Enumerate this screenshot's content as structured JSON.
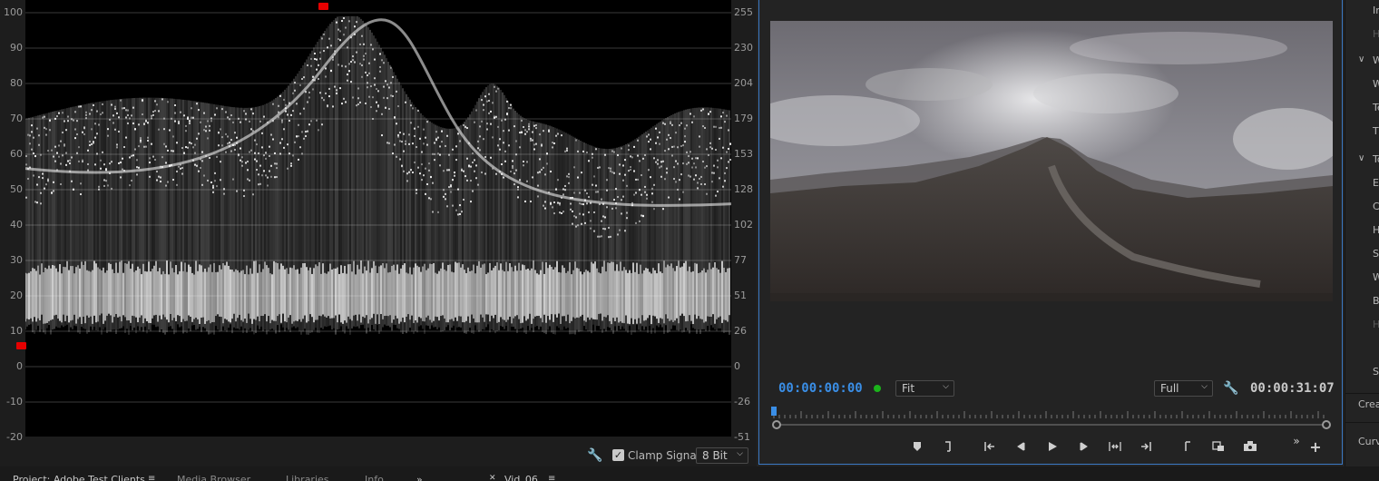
{
  "scope": {
    "left_ticks": [
      "100",
      "90",
      "80",
      "70",
      "60",
      "50",
      "40",
      "30",
      "20",
      "10",
      "0",
      "-10",
      "-20"
    ],
    "right_ticks": [
      "255",
      "230",
      "204",
      "179",
      "153",
      "128",
      "102",
      "77",
      "51",
      "26",
      "0",
      "-26",
      "-51"
    ],
    "clamp_label": "Clamp Signal",
    "clamp_checked": true,
    "bit_depth": "8 Bit"
  },
  "monitor": {
    "current_timecode": "00:00:00:00",
    "duration_timecode": "00:00:31:07",
    "zoom": "Fit",
    "resolution": "Full"
  },
  "transport": {
    "buttons": [
      "add-marker",
      "mark-in",
      "mark-out",
      "go-to-in",
      "step-back",
      "play",
      "step-forward",
      "go-to-out",
      "lift",
      "extract",
      "export-frame",
      "compare",
      "vr-view"
    ]
  },
  "right_panel": {
    "items": [
      {
        "label": "In",
        "dim": false
      },
      {
        "label": "H",
        "dim": true
      },
      {
        "label": "W",
        "dim": false,
        "chevron": true
      },
      {
        "label": "W",
        "dim": false
      },
      {
        "label": "Te",
        "dim": false
      },
      {
        "label": "Ti",
        "dim": false
      },
      {
        "label": "To",
        "dim": false,
        "chevron": true
      },
      {
        "label": "Ex",
        "dim": false
      },
      {
        "label": "C",
        "dim": false
      },
      {
        "label": "H",
        "dim": false
      },
      {
        "label": "Sh",
        "dim": false
      },
      {
        "label": "W",
        "dim": false
      },
      {
        "label": "B",
        "dim": false
      },
      {
        "label": "H",
        "dim": true
      },
      {
        "label": "Sa",
        "dim": false
      }
    ],
    "create_label": "Crea",
    "curves_label": "Curv"
  },
  "bottom_tabs": {
    "project": "Project: Adobe Test Clients",
    "media_browser": "Media Browser",
    "libraries": "Libraries",
    "info": "Info",
    "sequence": "Vid_06"
  },
  "colors": {
    "accent_blue": "#3a8ee6",
    "marker_red": "#e60000",
    "dot_green": "#1bb31b"
  }
}
